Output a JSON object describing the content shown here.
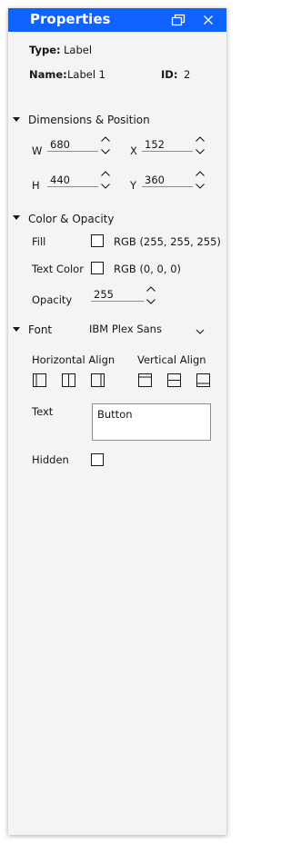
{
  "header": {
    "title": "Properties"
  },
  "info": {
    "type_label": "Type:",
    "type_value": "Label",
    "name_label": "Name:",
    "name_value": "Label 1",
    "id_label": "ID:",
    "id_value": "2"
  },
  "dimensions": {
    "section_title": "Dimensions & Position",
    "w_label": "W",
    "w_value": "680",
    "x_label": "X",
    "x_value": "152",
    "h_label": "H",
    "h_value": "440",
    "y_label": "Y",
    "y_value": "360"
  },
  "color": {
    "section_title": "Color & Opacity",
    "fill_label": "Fill",
    "fill_value": "RGB (255, 255, 255)",
    "text_color_label": "Text Color",
    "text_color_value": "RGB (0, 0, 0)",
    "opacity_label": "Opacity",
    "opacity_value": "255"
  },
  "font": {
    "section_title": "Font",
    "font_value": "IBM Plex Sans",
    "horizontal_align_label": "Horizontal Align",
    "vertical_align_label": "Vertical Align",
    "text_label": "Text",
    "text_value": "Button",
    "hidden_label": "Hidden"
  },
  "colors": {
    "accent": "#0f62fe",
    "panel_bg": "#f4f4f4",
    "text": "#161616"
  }
}
